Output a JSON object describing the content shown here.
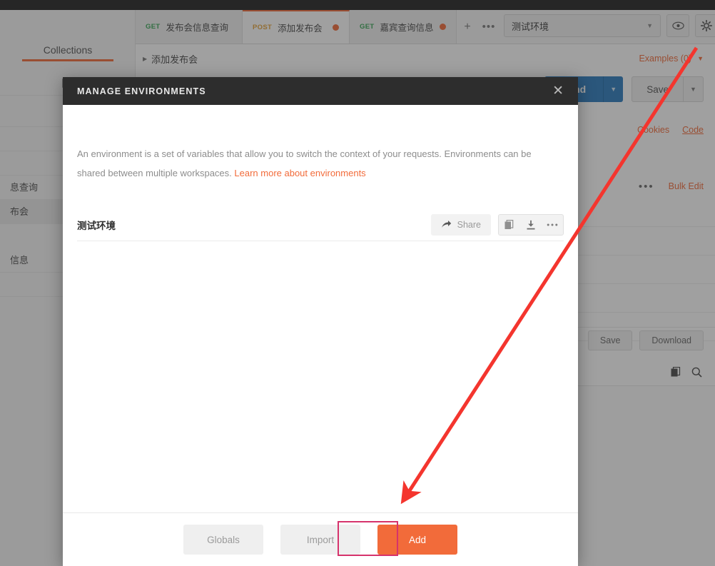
{
  "app": {
    "sidebar": {
      "tab_label": "Collections",
      "toolbar_icon": "collection-icon",
      "items": [
        {
          "label": ""
        },
        {
          "label": ""
        },
        {
          "label": ""
        },
        {
          "label": "息查询"
        },
        {
          "label": "布会"
        },
        {
          "label": ""
        },
        {
          "label": "信息"
        },
        {
          "label": ""
        }
      ],
      "selected_index": 4
    },
    "tabs": [
      {
        "method": "GET",
        "title": "发布会信息查询",
        "unsaved": false,
        "active": false
      },
      {
        "method": "POST",
        "title": "添加发布会",
        "unsaved": true,
        "active": true
      },
      {
        "method": "GET",
        "title": "嘉宾查询信息",
        "unsaved": true,
        "active": false
      }
    ],
    "tab_add_label": "+",
    "tab_more_label": "•••",
    "environment": {
      "selected": "测试环境",
      "caret": "▼",
      "eye_icon": "eye-icon",
      "gear_icon": "gear-icon"
    },
    "breadcrumb": {
      "triangle": "▶",
      "label": "添加发布会"
    },
    "examples": {
      "label": "Examples (0)",
      "caret": "▼"
    },
    "actions": {
      "send_label": "Send",
      "send_caret": "▼",
      "save_label": "Save",
      "save_caret": "▼"
    },
    "links": {
      "cookies": "Cookies",
      "code": "Code"
    },
    "params_row": {
      "dots": "•••",
      "bulk_edit": "Bulk Edit"
    },
    "response_actions": {
      "save": "Save",
      "download": "Download"
    },
    "response_icons": {
      "copy": "copy-icon",
      "search": "search-icon"
    }
  },
  "modal": {
    "title": "MANAGE ENVIRONMENTS",
    "close_icon": "close-icon",
    "description_part1": "An environment is a set of variables that allow you to switch the context of your requests. Environments can be shared between multiple workspaces.",
    "description_link": "Learn more about environments",
    "environments": [
      {
        "name": "测试环境",
        "share_label": "Share",
        "share_icon": "share-arrow-icon",
        "copy_icon": "duplicate-icon",
        "download_icon": "download-icon",
        "more_icon": "more-horizontal-icon"
      }
    ],
    "footer": {
      "globals_label": "Globals",
      "import_label": "Import",
      "add_label": "Add"
    }
  },
  "annotation": {
    "arrow_color": "#f4352e",
    "highlight_color": "#d6336c",
    "target": "Globals"
  }
}
